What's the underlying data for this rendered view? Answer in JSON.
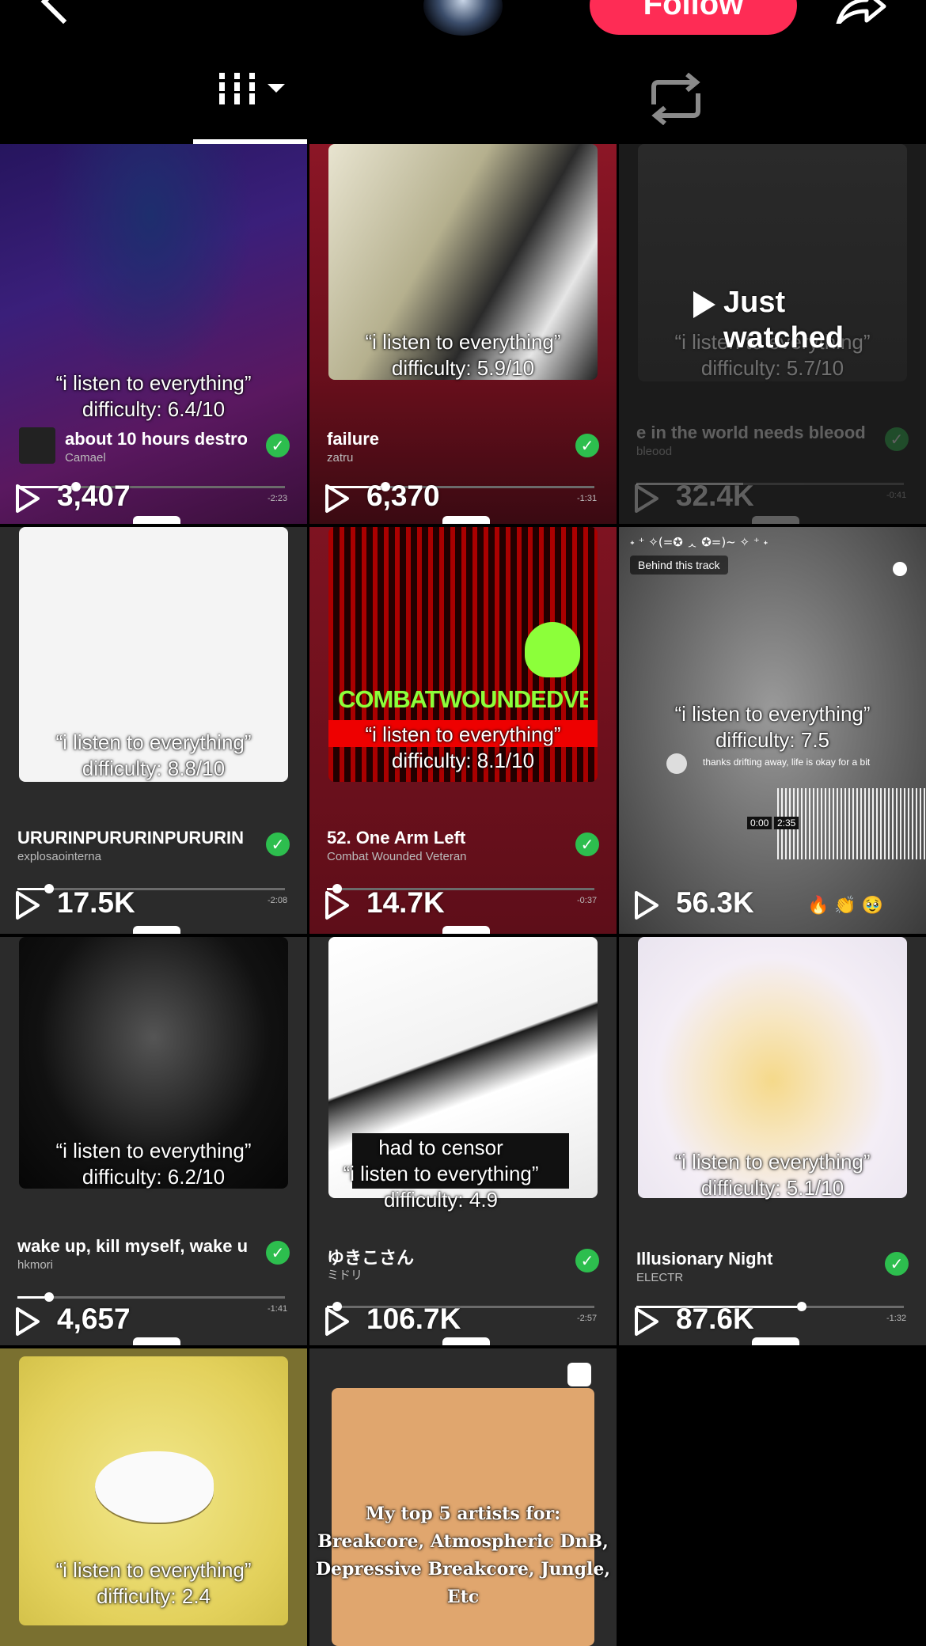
{
  "header": {
    "follow_label": "Follow"
  },
  "tabs": [
    {
      "name": "videos-grid-tab",
      "selected": true
    },
    {
      "name": "reposts-tab",
      "selected": false
    }
  ],
  "videos": [
    {
      "overlay": "“i listen to everything”\ndifficulty: 6.4/10",
      "title": "about 10 hours destro",
      "artist": "Camael",
      "remain": "-2:23",
      "views": "3,407",
      "progress": 0.2
    },
    {
      "overlay": "“i listen to everything”\ndifficulty: 5.9/10",
      "title": "failure",
      "artist": "zatru",
      "remain": "-1:31",
      "views": "6,370",
      "progress": 0.2
    },
    {
      "overlay": "“i listen to everything”\ndifficulty: 5.7/10",
      "title": "e in the world needs bleood",
      "artist": "bleood",
      "remain": "-0:41",
      "views": "32.4K",
      "progress": 0.4,
      "badge": "Just\nwatched"
    },
    {
      "overlay": "“i listen to everything”\ndifficulty: 8.8/10",
      "title": "URURINPURURINPURURIN",
      "artist": "explosaointerna",
      "remain": "-2:08",
      "views": "17.5K",
      "progress": 0.1
    },
    {
      "overlay": "“i listen to everything”\ndifficulty: 8.1/10",
      "title": "52. One Arm Left",
      "artist": "Combat Wounded Veteran",
      "remain": "-0:37",
      "views": "14.7K",
      "progress": 0.02,
      "art_text": "COMBATWOUNDEDVETERAN"
    },
    {
      "overlay": "“i listen to everything”\ndifficulty: 7.5",
      "title": "",
      "artist": "",
      "remain": "",
      "views": "56.3K",
      "progress": 0,
      "top_text": "˖ ⁺ ✧(=✪ ᆺ ✪=)~ ✧ ⁺ ˖",
      "track_label": "Behind this track",
      "comment": "thanks drifting away, life is okay for a bit",
      "time_a": "0:00",
      "time_b": "2:35",
      "emoji": "🔥 👏 🥹"
    },
    {
      "overlay": "“i listen to everything”\ndifficulty: 6.2/10",
      "title": "wake up, kill myself, wake u",
      "artist": "hkmori",
      "remain": "-1:41",
      "views": "4,657",
      "progress": 0.1
    },
    {
      "overlay": "had to censor\n“i listen to everything”\ndifficulty: 4.9",
      "title": "ゆきこさん",
      "artist": "ミドリ",
      "remain": "-2:57",
      "views": "106.7K",
      "progress": 0.02
    },
    {
      "overlay": "“i listen to everything”\ndifficulty: 5.1/10",
      "title": "Illusionary Night",
      "artist": "ELECTR",
      "remain": "-1:32",
      "views": "87.6K",
      "progress": 0.6
    },
    {
      "overlay": "“i listen to everything”\ndifficulty: 2.4"
    },
    {
      "overlay": "My top 5 artists for:\nBreakcore, Atmospheric DnB,\nDepressive Breakcore, Jungle,\nEtc"
    }
  ],
  "colors": {
    "accent": "#fe2c55",
    "verified": "#2dbe4e"
  }
}
